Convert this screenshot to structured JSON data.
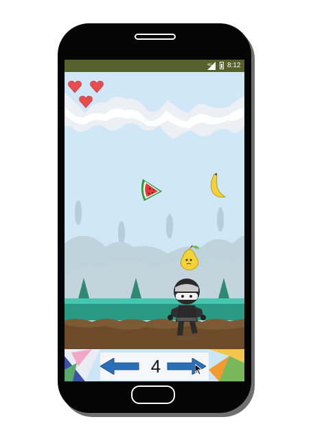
{
  "status_bar": {
    "time": "8:12",
    "network_label": "4G"
  },
  "game": {
    "lives": 3,
    "score": "4",
    "fruits": [
      "watermelon",
      "banana",
      "pear"
    ],
    "character": "ninja"
  },
  "controls": {
    "left_icon": "arrow-left-icon",
    "right_icon": "arrow-right-icon"
  },
  "colors": {
    "status_bar": "#56602b",
    "sky": "#cde6f7",
    "grass": "#3aa38f",
    "dirt": "#7c5a33",
    "heart": "#e44b4b",
    "arrow": "#2b6fb8"
  }
}
